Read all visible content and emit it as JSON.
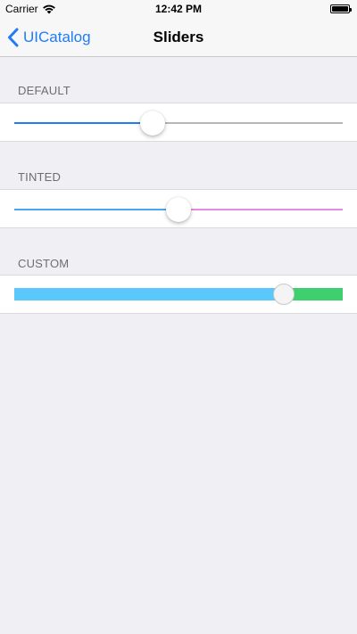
{
  "status_bar": {
    "carrier": "Carrier",
    "time": "12:42 PM",
    "icons": [
      "wifi-icon",
      "battery-icon"
    ]
  },
  "nav": {
    "back_label": "UICatalog",
    "title": "Sliders",
    "back_icon": "chevron-left-icon",
    "accent_color": "#1f7cf6"
  },
  "sections": [
    {
      "header": "DEFAULT",
      "slider": {
        "value": 0.42,
        "min_color": "#1f7cf6",
        "max_color": "#b6b6b6"
      }
    },
    {
      "header": "TINTED",
      "slider": {
        "value": 0.5,
        "min_color": "#4aa7ee",
        "max_color": "#e58be1"
      }
    },
    {
      "header": "CUSTOM",
      "slider": {
        "value": 0.82,
        "min_color": "#5ac8fa",
        "max_color": "#3ecf6e"
      }
    }
  ]
}
